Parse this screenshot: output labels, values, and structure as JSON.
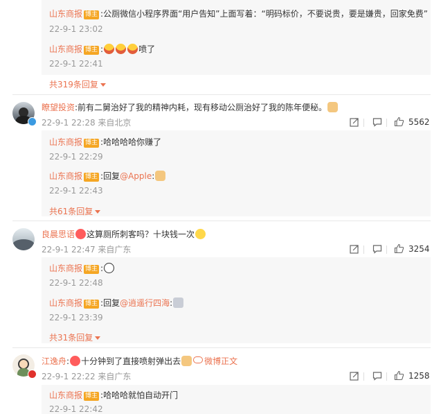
{
  "blogger_tag": "博主",
  "colors": {
    "accent": "#eb7350",
    "tag": "#f5a623",
    "reply_bg": "#f7f7f7",
    "muted": "#999999"
  },
  "thread1": {
    "replies": [
      {
        "name": "山东商报",
        "text": ":公厕微信小程序界面“用户告知”上面写着：“明码标价，不要说贵，要是嫌贵，回家免费”",
        "time": "22-9-1 23:02"
      },
      {
        "name": "山东商报",
        "prefix": ":",
        "emoji": [
          "laugh-emoji",
          "laugh-emoji",
          "laugh-emoji"
        ],
        "text": "喷了",
        "time": "22-9-1 22:41"
      }
    ],
    "more": "共319条回复"
  },
  "comments": [
    {
      "user": "瞭望投资",
      "badge_color": "#3b9ae1",
      "text": ":前有二舅治好了我的精神内耗，现有移动公厕治好了我的陈年便秘。",
      "emoji_after": "cat-emoji",
      "time": "22-9-1 22:28 来自北京",
      "likes": "5562",
      "replies": [
        {
          "name": "山东商报",
          "text": ":哈哈哈哈你赚了",
          "time": "22-9-1 22:29"
        },
        {
          "name": "山东商报",
          "prefix": ":回复",
          "mention": "@Apple",
          "suffix": ":",
          "emoji_after": "cat-emoji",
          "time": "22-9-1 22:43"
        }
      ],
      "more": "共61条回复"
    },
    {
      "user": "良晨思语",
      "text": "这算厕所刺客吗？十块钱一次",
      "emoji_before": "love-emoji",
      "emoji_after": "sweat-emoji",
      "time": "22-9-1 22:47 来自广东",
      "likes": "3254",
      "replies": [
        {
          "name": "山东商报",
          "prefix": ":",
          "emoji_after": "panda-emoji",
          "time": "22-9-1 22:48"
        },
        {
          "name": "山东商报",
          "prefix": ":回复",
          "mention": "@逍遥行四海",
          "suffix": ":",
          "emoji_after": "robot-emoji",
          "time": "22-9-1 23:39"
        }
      ],
      "more": "共31条回复"
    },
    {
      "user": "江逸舟",
      "badge_color": "#e0312c",
      "text": "十分钟到了直接喷射弹出去",
      "emoji_before": "love-emoji",
      "prefix": ":",
      "emoji_after": "cat-emoji",
      "link_text": "微博正文",
      "time": "22-9-1 22:22 来自广东",
      "likes": "1258",
      "replies": [
        {
          "name": "山东商报",
          "text": ":哈哈哈就怕自动开门",
          "time": "22-9-1 22:42"
        }
      ]
    }
  ]
}
